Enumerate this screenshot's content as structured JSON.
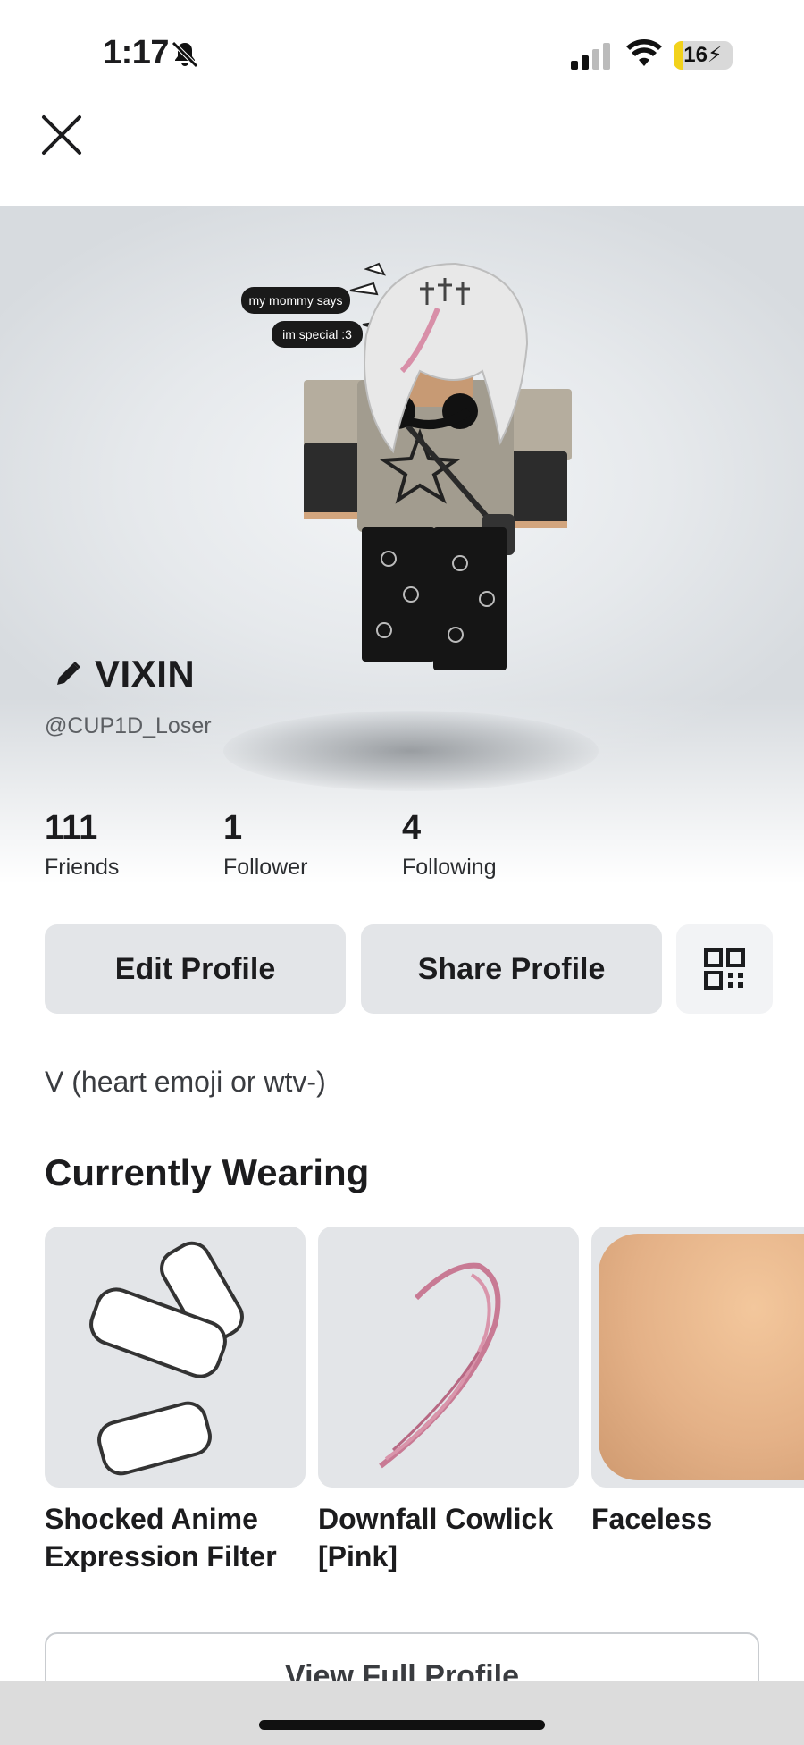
{
  "status_bar": {
    "time": "1:17",
    "battery_level": "16",
    "battery_percent": 16
  },
  "profile": {
    "display_name": "VIXIN",
    "username": "@CUP1D_Loser",
    "bio": "V (heart emoji or wtv-)",
    "avatar_speech": [
      "my mommy says",
      "im special :3"
    ]
  },
  "stats": [
    {
      "value": "111",
      "label": "Friends"
    },
    {
      "value": "1",
      "label": "Follower"
    },
    {
      "value": "4",
      "label": "Following"
    }
  ],
  "actions": {
    "edit_profile": "Edit Profile",
    "share_profile": "Share Profile",
    "qr_icon": "qr-code-icon"
  },
  "currently_wearing": {
    "title": "Currently Wearing",
    "items": [
      {
        "name": "Shocked Anime Expression Filter"
      },
      {
        "name": "Downfall Cowlick [Pink]"
      },
      {
        "name": "Faceless"
      }
    ]
  },
  "footer": {
    "view_full_profile": "View Full Profile"
  },
  "icons": [
    "close-icon",
    "bell-off-icon",
    "signal-icon",
    "wifi-icon",
    "battery-icon",
    "pencil-icon",
    "qr-code-icon"
  ]
}
